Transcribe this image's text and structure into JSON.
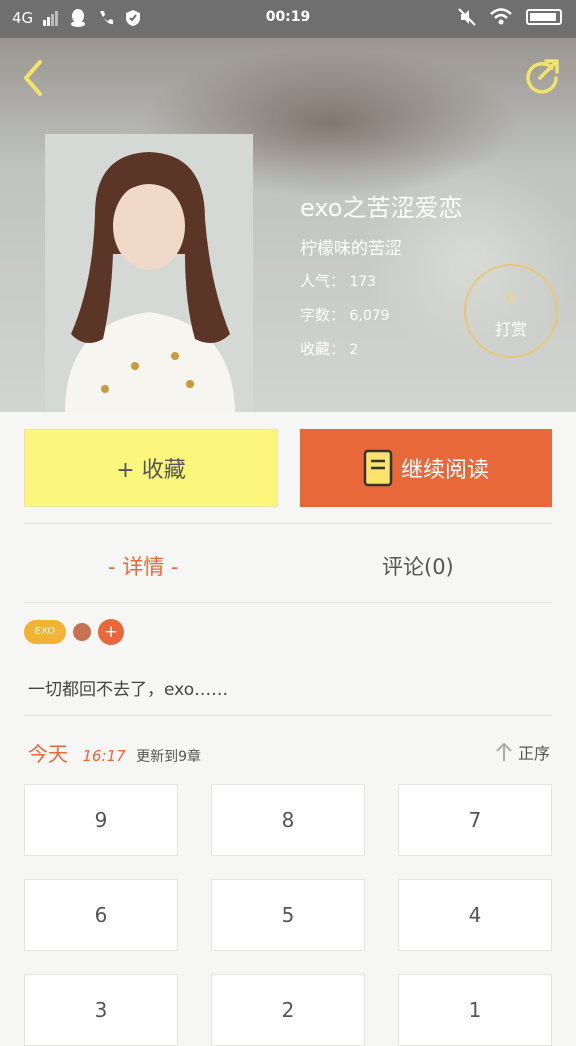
{
  "status_bar": {
    "network": "4G",
    "time": "00:19"
  },
  "book": {
    "title": "exo之苦涩爱恋",
    "author": "柠檬味的苦涩",
    "popularity_label": "人气：",
    "popularity_value": "173",
    "words_label": "字数：",
    "words_value": "6,079",
    "favorites_label": "收藏：",
    "favorites_value": "2"
  },
  "tip": {
    "count": "0",
    "label": "打赏"
  },
  "actions": {
    "favorite_label": "+ 收藏",
    "continue_label": "继续阅读"
  },
  "tabs": {
    "detail": "- 详情 -",
    "comments": "评论(0)"
  },
  "tags": {
    "first": "EXO",
    "add": "+"
  },
  "description": "一切都回不去了，exo……",
  "update": {
    "today": "今天",
    "time": "16:17",
    "text": "更新到9章",
    "sort": "正序"
  },
  "chapters": [
    "9",
    "8",
    "7",
    "6",
    "5",
    "4",
    "3",
    "2",
    "1"
  ],
  "colors": {
    "accent": "#e8683a",
    "favorite_bg": "#fdf67d",
    "tag": "#f2b335"
  }
}
